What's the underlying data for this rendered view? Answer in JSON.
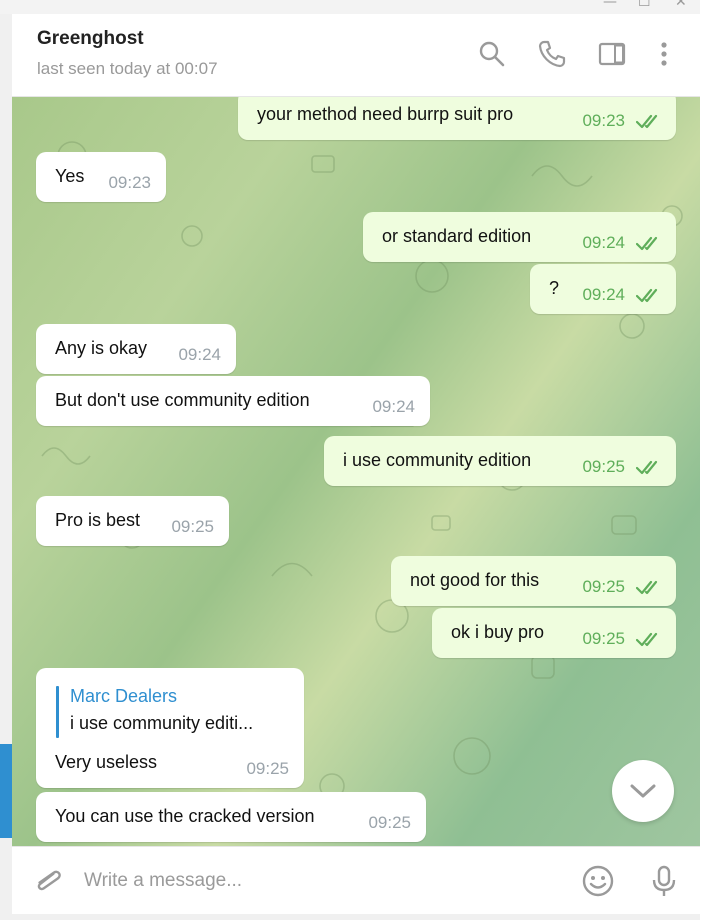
{
  "header": {
    "contact_name": "Greenghost",
    "status": "last seen today at 00:07"
  },
  "icons": {
    "search": "search-icon",
    "call": "phone-icon",
    "sidebar": "sidebar-panel-icon",
    "menu": "more-vertical-icon",
    "attach": "paperclip-icon",
    "emoji": "smiley-icon",
    "voice": "microphone-icon",
    "scroll": "chevron-down-icon"
  },
  "messages": [
    {
      "dir": "out",
      "text": "your method need burrp suit pro",
      "time": "09:23",
      "read": true
    },
    {
      "dir": "in",
      "text": "Yes",
      "time": "09:23"
    },
    {
      "dir": "out",
      "text": "or standard edition",
      "time": "09:24",
      "read": true
    },
    {
      "dir": "out",
      "text": "?",
      "time": "09:24",
      "read": true
    },
    {
      "dir": "in",
      "text": "Any is okay",
      "time": "09:24"
    },
    {
      "dir": "in",
      "text": "But don't use community edition",
      "time": "09:24"
    },
    {
      "dir": "out",
      "text": "i use community edition",
      "time": "09:25",
      "read": true
    },
    {
      "dir": "in",
      "text": "Pro is best",
      "time": "09:25"
    },
    {
      "dir": "out",
      "text": "not good for this",
      "time": "09:25",
      "read": true
    },
    {
      "dir": "out",
      "text": "ok i buy pro",
      "time": "09:25",
      "read": true
    },
    {
      "dir": "in",
      "reply_to": {
        "name": "Marc Dealers",
        "text": "i use community editi..."
      },
      "text": "Very useless",
      "time": "09:25"
    },
    {
      "dir": "in",
      "text": "You can use the cracked version",
      "time": "09:25"
    }
  ],
  "composer": {
    "placeholder": "Write a message..."
  },
  "colors": {
    "accent": "#2f8fd0",
    "out_bubble": "#effdde",
    "in_bubble": "#ffffff",
    "read_check": "#5fae5a"
  }
}
